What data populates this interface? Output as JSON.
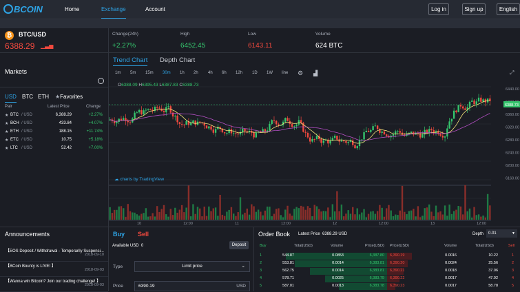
{
  "brand": {
    "name": "BCOIN"
  },
  "nav": {
    "home": "Home",
    "exchange": "Exchange",
    "account": "Account"
  },
  "auth": {
    "login": "Log in",
    "signup": "Sign up",
    "language": "English"
  },
  "ticker": {
    "pair": "BTC/USD",
    "price": "6388.29",
    "change_label": "Change(24h)",
    "change": "+2.27%",
    "high_label": "High",
    "high": "6452.45",
    "low_label": "Low",
    "low": "6143.11",
    "volume_label": "Volume",
    "volume": "624 BTC"
  },
  "markets": {
    "title": "Markets",
    "tabs": [
      "USD",
      "BTC",
      "ETH",
      "Favorites"
    ],
    "headers": [
      "Pair",
      "Latest Price",
      "Change"
    ],
    "rows": [
      {
        "coin": "BTC",
        "quote": "/ USD",
        "price": "6,388.29",
        "change": "+2.27%"
      },
      {
        "coin": "BCH",
        "quote": "/ USD",
        "price": "433.84",
        "change": "+4.07%"
      },
      {
        "coin": "ETH",
        "quote": "/ USD",
        "price": "188.15",
        "change": "+11.74%"
      },
      {
        "coin": "ETC",
        "quote": "/ USD",
        "price": "10.75",
        "change": "+5.18%"
      },
      {
        "coin": "LTC",
        "quote": "/ USD",
        "price": "52.42",
        "change": "+7.00%"
      }
    ]
  },
  "chart": {
    "tabs": [
      "Trend Chart",
      "Depth Chart"
    ],
    "timeframes": [
      "1m",
      "5m",
      "15m",
      "30m",
      "1h",
      "2h",
      "4h",
      "6h",
      "12h",
      "1D",
      "1W",
      "line"
    ],
    "active_timeframe": "30m",
    "ohlc": {
      "o_label": "O",
      "o": "6388.09",
      "h_label": "H",
      "h": "6395.43",
      "l_label": "L",
      "l": "6387.83",
      "c_label": "C",
      "c": "6388.73"
    },
    "price_ticks": [
      "6440.00",
      "6400.00",
      "6360.00",
      "6320.00",
      "6280.00",
      "6240.00",
      "6200.00",
      "6160.00"
    ],
    "current_label": "6388.73",
    "time_ticks": [
      "10",
      "12:00",
      "11",
      "12:00",
      "12",
      "12:00",
      "13",
      "12:00"
    ],
    "watermark": "charts by TradingView"
  },
  "announcements": {
    "title": "Announcements",
    "items": [
      {
        "text": "【EOS Deposit / Withdrawal - Temporarily Suspensi...",
        "date": "2018-09-10"
      },
      {
        "text": "【BCoin Bounty is LIVE! 】",
        "date": "2018-09-03"
      },
      {
        "text": "【Wanna win Bitcoin? Join our trading challenge! 】",
        "date": "2018-09-03"
      }
    ]
  },
  "trade": {
    "buy": "Buy",
    "sell": "Sell",
    "available_label": "Available USD",
    "available": "0",
    "deposit": "Deposit",
    "type_label": "Type",
    "type": "Limit price",
    "price_label": "Price",
    "price": "6390.19",
    "price_unit": "USD"
  },
  "orderbook": {
    "title": "Order Book",
    "latest_label": "Latest Price",
    "latest": "6388.29 USD",
    "depth_label": "Depth",
    "depth": "0.01",
    "headers": [
      "Buy",
      "Total(USD)",
      "Volume",
      "Price(USD)",
      "Price(USD)",
      "Volume",
      "Total(USD)",
      "Sell"
    ],
    "rows": [
      {
        "n": "1",
        "bt": "544.87",
        "bv": "0.0853",
        "bp": "6,387.80",
        "sp": "6,390.19",
        "sv": "0.0016",
        "st": "10.22",
        "sn": "1"
      },
      {
        "n": "2",
        "bt": "553.81",
        "bv": "0.0014",
        "bp": "6,383.81",
        "sp": "6,390.20",
        "sv": "0.0024",
        "st": "25.56",
        "sn": "2"
      },
      {
        "n": "3",
        "bt": "562.75",
        "bv": "0.0014",
        "bp": "6,383.81",
        "sp": "6,390.21",
        "sv": "0.0018",
        "st": "37.06",
        "sn": "3"
      },
      {
        "n": "4",
        "bt": "578.71",
        "bv": "0.0025",
        "bp": "6,383.79",
        "sp": "6,390.22",
        "sv": "0.0017",
        "st": "47.92",
        "sn": "4"
      },
      {
        "n": "5",
        "bt": "587.01",
        "bv": "0.0013",
        "bp": "6,383.78",
        "sp": "6,390.23",
        "sv": "0.0017",
        "st": "58.78",
        "sn": "5"
      }
    ]
  },
  "colors": {
    "accent": "#2ea4e6",
    "up": "#35c56d",
    "down": "#f0493e",
    "bg": "#1b1d24"
  }
}
